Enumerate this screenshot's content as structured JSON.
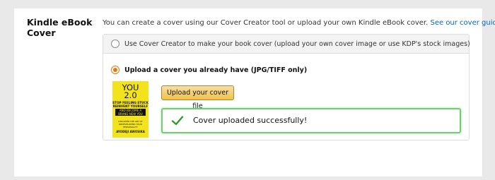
{
  "section": {
    "label": "Kindle eBook Cover"
  },
  "intro": {
    "text": "You can create a cover using our Cover Creator tool or upload your own Kindle eBook cover.",
    "link": "See our cover guidelines."
  },
  "options": [
    {
      "label": "Use Cover Creator to make your book cover (upload your own cover image or use KDP's stock images)",
      "selected": false
    },
    {
      "label": "Upload a cover you already have (JPG/TIFF only)",
      "selected": true
    }
  ],
  "cover": {
    "title_line1": "YOU",
    "title_line2": "2.0",
    "subtitle1": "STOP FEELING STUCK REINVENT YOURSELF",
    "subtitle2": "AND BECOME A BRAND NEW YOU",
    "tagline": "DISCOVER THE ART OF REDEVELOPING YOUR PERSONALITY",
    "author": "AYODEJI AWOSIKA"
  },
  "upload_button": {
    "label": "Upload your cover file"
  },
  "status": {
    "message": "Cover uploaded successfully!",
    "accent_color": "#6fce6f",
    "icon": "checkmark-icon"
  },
  "colors": {
    "radio_selected": "#e47911",
    "link": "#0066c0",
    "button": "#f0c14b"
  }
}
